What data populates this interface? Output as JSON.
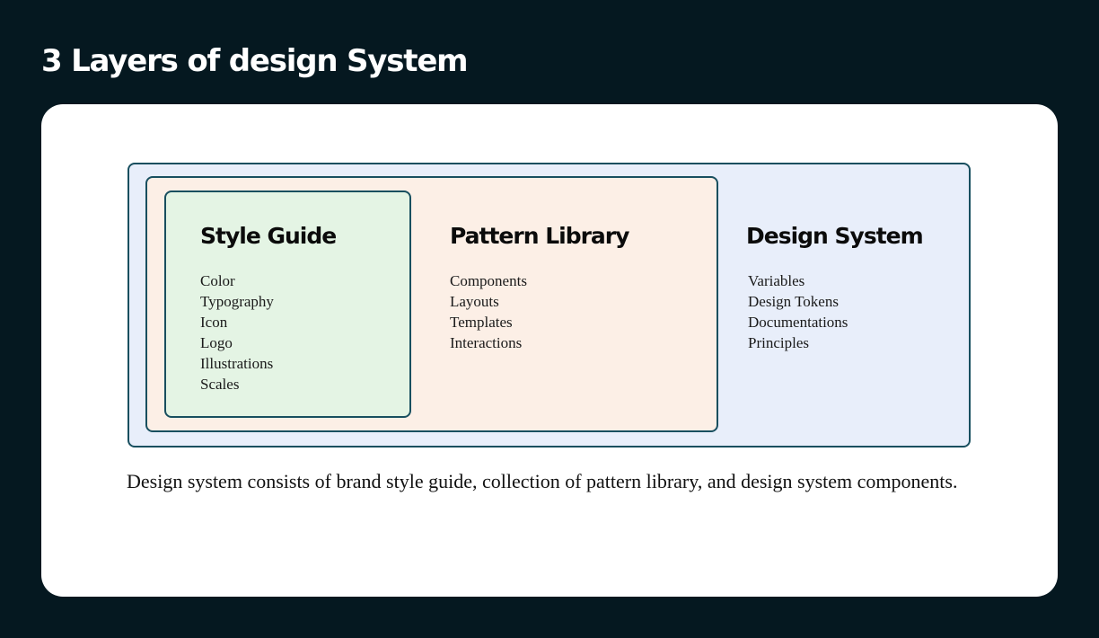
{
  "page": {
    "title": "3 Layers of design System"
  },
  "layers": {
    "style_guide": {
      "title": "Style Guide",
      "items": [
        "Color",
        "Typography",
        "Icon",
        "Logo",
        "Illustrations",
        "Scales"
      ],
      "fill": "#e4f4e4"
    },
    "pattern_library": {
      "title": "Pattern Library",
      "items": [
        "Components",
        "Layouts",
        "Templates",
        "Interactions"
      ],
      "fill": "#fcefe6"
    },
    "design_system": {
      "title": "Design System",
      "items": [
        "Variables",
        "Design Tokens",
        "Documentations",
        "Principles"
      ],
      "fill": "#e8eefa"
    }
  },
  "description": "Design system consists of brand style guide, collection of pattern library, and design system components.",
  "colors": {
    "background": "#051820",
    "card": "#ffffff",
    "border": "#184f5f"
  }
}
